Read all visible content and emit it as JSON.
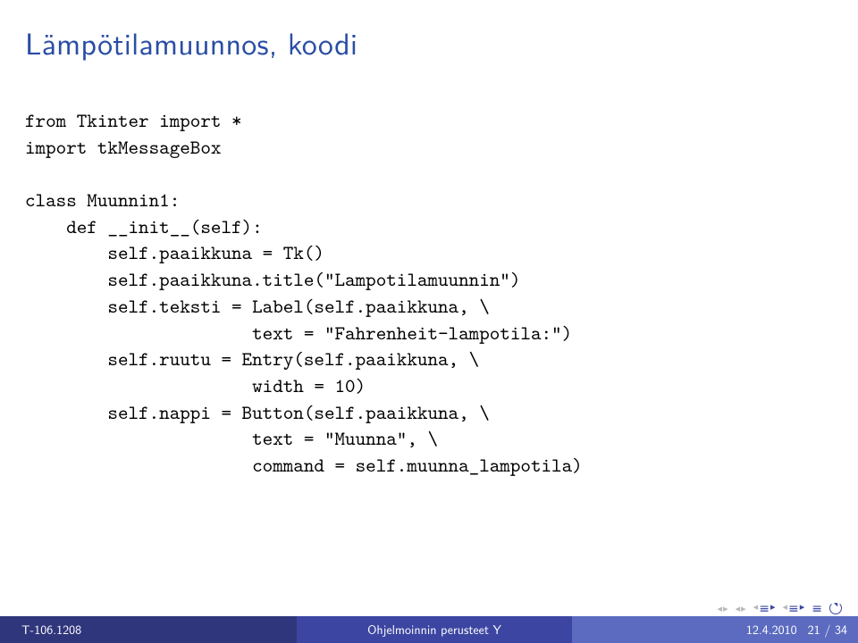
{
  "title": "Lämpötilamuunnos, koodi",
  "code": "from Tkinter import *\nimport tkMessageBox\n\nclass Muunnin1:\n    def __init__(self):\n        self.paaikkuna = Tk()\n        self.paaikkuna.title(\"Lampotilamuunnin\")\n        self.teksti = Label(self.paaikkuna, \\\n                      text = \"Fahrenheit-lampotila:\")\n        self.ruutu = Entry(self.paaikkuna, \\\n                      width = 10)\n        self.nappi = Button(self.paaikkuna, \\\n                      text = \"Muunna\", \\\n                      command = self.muunna_lampotila)",
  "footer": {
    "left": "T-106.1208",
    "center": "Ohjelmoinnin perusteet Y",
    "date": "12.4.2010",
    "page": "21 / 34"
  }
}
